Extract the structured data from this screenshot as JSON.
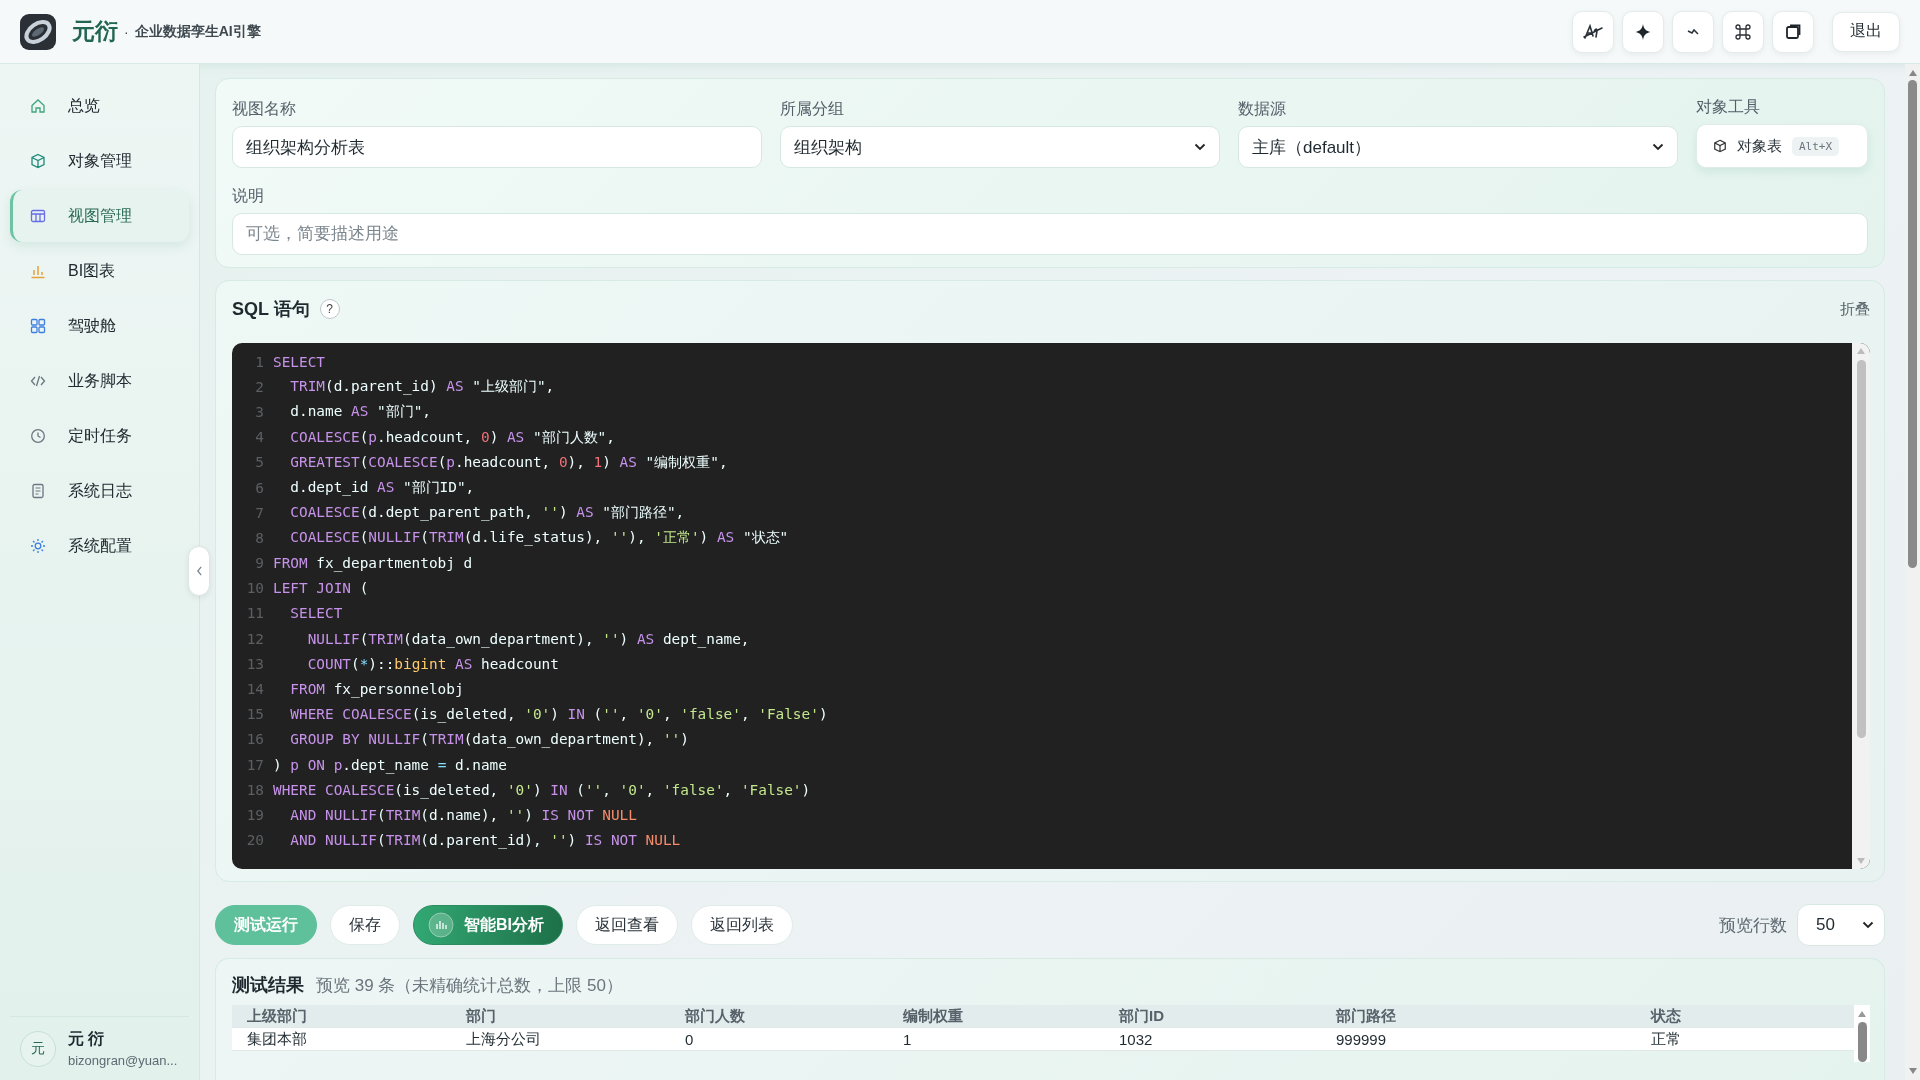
{
  "app": {
    "name": "元衍",
    "separator": "·",
    "tagline": "企业数据孪生AI引擎"
  },
  "toolbar": {
    "logout": "退出"
  },
  "sidebar": {
    "items": [
      {
        "label": "总览",
        "selected": false
      },
      {
        "label": "对象管理",
        "selected": false
      },
      {
        "label": "视图管理",
        "selected": true
      },
      {
        "label": "BI图表",
        "selected": false
      },
      {
        "label": "驾驶舱",
        "selected": false
      },
      {
        "label": "业务脚本",
        "selected": false
      },
      {
        "label": "定时任务",
        "selected": false
      },
      {
        "label": "系统日志",
        "selected": false
      },
      {
        "label": "系统配置",
        "selected": false
      }
    ]
  },
  "user": {
    "avatar": "元",
    "name": "元 衍",
    "email": "bizongran@yuan..."
  },
  "form": {
    "fields": [
      {
        "label": "视图名称",
        "value": "组织架构分析表",
        "kind": "input"
      },
      {
        "label": "所属分组",
        "value": "组织架构",
        "kind": "select"
      },
      {
        "label": "数据源",
        "value": "主库（default）",
        "kind": "select"
      }
    ],
    "object_tool": {
      "label": "对象工具",
      "button": "对象表",
      "shortcut": "Alt+X"
    },
    "description": {
      "label": "说明",
      "placeholder": "可选，简要描述用途"
    }
  },
  "sql": {
    "title": "SQL 语句",
    "help": "?",
    "collapse": "折叠",
    "lines": [
      {
        "n": "1",
        "tokens": [
          {
            "kind": "kw",
            "text": "SELECT"
          }
        ]
      },
      {
        "n": "2",
        "tokens": [
          {
            "kind": "kw",
            "text": "  TRIM"
          },
          {
            "kind": "plain",
            "text": "(d.parent_id) "
          },
          {
            "kind": "kw",
            "text": "AS"
          },
          {
            "kind": "plain",
            "text": " \"上级部门\","
          }
        ]
      },
      {
        "n": "3",
        "tokens": [
          {
            "kind": "plain",
            "text": "  d.name "
          },
          {
            "kind": "kw",
            "text": "AS"
          },
          {
            "kind": "plain",
            "text": " \"部门\","
          }
        ]
      },
      {
        "n": "4",
        "tokens": [
          {
            "kind": "kw",
            "text": "  COALESCE"
          },
          {
            "kind": "plain",
            "text": "("
          },
          {
            "kind": "kw",
            "text": "p"
          },
          {
            "kind": "plain",
            "text": ".headcount, "
          },
          {
            "kind": "num",
            "text": "0"
          },
          {
            "kind": "plain",
            "text": ") "
          },
          {
            "kind": "kw",
            "text": "AS"
          },
          {
            "kind": "plain",
            "text": " \"部门人数\","
          }
        ]
      },
      {
        "n": "5",
        "tokens": [
          {
            "kind": "kw",
            "text": "  GREATEST"
          },
          {
            "kind": "plain",
            "text": "("
          },
          {
            "kind": "kw",
            "text": "COALESCE"
          },
          {
            "kind": "plain",
            "text": "("
          },
          {
            "kind": "kw",
            "text": "p"
          },
          {
            "kind": "plain",
            "text": ".headcount, "
          },
          {
            "kind": "num",
            "text": "0"
          },
          {
            "kind": "plain",
            "text": "), "
          },
          {
            "kind": "num",
            "text": "1"
          },
          {
            "kind": "plain",
            "text": ") "
          },
          {
            "kind": "kw",
            "text": "AS"
          },
          {
            "kind": "plain",
            "text": " \"编制权重\","
          }
        ]
      },
      {
        "n": "6",
        "tokens": [
          {
            "kind": "plain",
            "text": "  d.dept_id "
          },
          {
            "kind": "kw",
            "text": "AS"
          },
          {
            "kind": "plain",
            "text": " \"部门ID\","
          }
        ]
      },
      {
        "n": "7",
        "tokens": [
          {
            "kind": "kw",
            "text": "  COALESCE"
          },
          {
            "kind": "plain",
            "text": "(d.dept_parent_path, "
          },
          {
            "kind": "str",
            "text": "''"
          },
          {
            "kind": "plain",
            "text": ") "
          },
          {
            "kind": "kw",
            "text": "AS"
          },
          {
            "kind": "plain",
            "text": " \"部门路径\","
          }
        ]
      },
      {
        "n": "8",
        "tokens": [
          {
            "kind": "kw",
            "text": "  COALESCE"
          },
          {
            "kind": "plain",
            "text": "("
          },
          {
            "kind": "kw",
            "text": "NULLIF"
          },
          {
            "kind": "plain",
            "text": "("
          },
          {
            "kind": "kw",
            "text": "TRIM"
          },
          {
            "kind": "plain",
            "text": "(d.life_status), "
          },
          {
            "kind": "str",
            "text": "''"
          },
          {
            "kind": "plain",
            "text": "), "
          },
          {
            "kind": "str",
            "text": "'正常'"
          },
          {
            "kind": "plain",
            "text": ") "
          },
          {
            "kind": "kw",
            "text": "AS"
          },
          {
            "kind": "plain",
            "text": " \"状态\""
          }
        ]
      },
      {
        "n": "9",
        "tokens": [
          {
            "kind": "kw",
            "text": "FROM"
          },
          {
            "kind": "plain",
            "text": " fx_departmentobj d"
          }
        ]
      },
      {
        "n": "10",
        "tokens": [
          {
            "kind": "kw",
            "text": "LEFT JOIN"
          },
          {
            "kind": "plain",
            "text": " ("
          }
        ]
      },
      {
        "n": "11",
        "tokens": [
          {
            "kind": "kw",
            "text": "  SELECT"
          }
        ]
      },
      {
        "n": "12",
        "tokens": [
          {
            "kind": "kw",
            "text": "    NULLIF"
          },
          {
            "kind": "plain",
            "text": "("
          },
          {
            "kind": "kw",
            "text": "TRIM"
          },
          {
            "kind": "plain",
            "text": "(data_own_department), "
          },
          {
            "kind": "str",
            "text": "''"
          },
          {
            "kind": "plain",
            "text": ") "
          },
          {
            "kind": "kw",
            "text": "AS"
          },
          {
            "kind": "plain",
            "text": " dept_name,"
          }
        ]
      },
      {
        "n": "13",
        "tokens": [
          {
            "kind": "kw",
            "text": "    COUNT"
          },
          {
            "kind": "plain",
            "text": "("
          },
          {
            "kind": "op",
            "text": "*"
          },
          {
            "kind": "plain",
            "text": ")::"
          },
          {
            "kind": "type",
            "text": "bigint"
          },
          {
            "kind": "kw",
            "text": " AS"
          },
          {
            "kind": "plain",
            "text": " headcount"
          }
        ]
      },
      {
        "n": "14",
        "tokens": [
          {
            "kind": "kw",
            "text": "  FROM"
          },
          {
            "kind": "plain",
            "text": " fx_personnelobj"
          }
        ]
      },
      {
        "n": "15",
        "tokens": [
          {
            "kind": "kw",
            "text": "  WHERE COALESCE"
          },
          {
            "kind": "plain",
            "text": "(is_deleted, "
          },
          {
            "kind": "str",
            "text": "'0'"
          },
          {
            "kind": "plain",
            "text": ") "
          },
          {
            "kind": "kw",
            "text": "IN"
          },
          {
            "kind": "plain",
            "text": " ("
          },
          {
            "kind": "str",
            "text": "''"
          },
          {
            "kind": "plain",
            "text": ", "
          },
          {
            "kind": "str",
            "text": "'0'"
          },
          {
            "kind": "plain",
            "text": ", "
          },
          {
            "kind": "str",
            "text": "'false'"
          },
          {
            "kind": "plain",
            "text": ", "
          },
          {
            "kind": "str",
            "text": "'False'"
          },
          {
            "kind": "plain",
            "text": ")"
          }
        ]
      },
      {
        "n": "16",
        "tokens": [
          {
            "kind": "kw",
            "text": "  GROUP BY NULLIF"
          },
          {
            "kind": "plain",
            "text": "("
          },
          {
            "kind": "kw",
            "text": "TRIM"
          },
          {
            "kind": "plain",
            "text": "(data_own_department), "
          },
          {
            "kind": "str",
            "text": "''"
          },
          {
            "kind": "plain",
            "text": ")"
          }
        ]
      },
      {
        "n": "17",
        "tokens": [
          {
            "kind": "plain",
            "text": ") "
          },
          {
            "kind": "kw",
            "text": "p ON p"
          },
          {
            "kind": "plain",
            "text": ".dept_name "
          },
          {
            "kind": "op",
            "text": "="
          },
          {
            "kind": "plain",
            "text": " d.name"
          }
        ]
      },
      {
        "n": "18",
        "tokens": [
          {
            "kind": "kw",
            "text": "WHERE COALESCE"
          },
          {
            "kind": "plain",
            "text": "(is_deleted, "
          },
          {
            "kind": "str",
            "text": "'0'"
          },
          {
            "kind": "plain",
            "text": ") "
          },
          {
            "kind": "kw",
            "text": "IN"
          },
          {
            "kind": "plain",
            "text": " ("
          },
          {
            "kind": "str",
            "text": "''"
          },
          {
            "kind": "plain",
            "text": ", "
          },
          {
            "kind": "str",
            "text": "'0'"
          },
          {
            "kind": "plain",
            "text": ", "
          },
          {
            "kind": "str",
            "text": "'false'"
          },
          {
            "kind": "plain",
            "text": ", "
          },
          {
            "kind": "str",
            "text": "'False'"
          },
          {
            "kind": "plain",
            "text": ")"
          }
        ]
      },
      {
        "n": "19",
        "tokens": [
          {
            "kind": "kw",
            "text": "  AND NULLIF"
          },
          {
            "kind": "plain",
            "text": "("
          },
          {
            "kind": "kw",
            "text": "TRIM"
          },
          {
            "kind": "plain",
            "text": "(d.name), "
          },
          {
            "kind": "str",
            "text": "''"
          },
          {
            "kind": "plain",
            "text": ") "
          },
          {
            "kind": "kw",
            "text": "IS NOT"
          },
          {
            "kind": "null",
            "text": " NULL"
          }
        ]
      },
      {
        "n": "20",
        "tokens": [
          {
            "kind": "kw",
            "text": "  AND NULLIF"
          },
          {
            "kind": "plain",
            "text": "("
          },
          {
            "kind": "kw",
            "text": "TRIM"
          },
          {
            "kind": "plain",
            "text": "(d.parent_id), "
          },
          {
            "kind": "str",
            "text": "''"
          },
          {
            "kind": "plain",
            "text": ") "
          },
          {
            "kind": "kw",
            "text": "IS NOT"
          },
          {
            "kind": "null",
            "text": " NULL"
          }
        ]
      }
    ]
  },
  "actions": [
    {
      "label": "测试运行",
      "kind": "run"
    },
    {
      "label": "保存",
      "kind": "plain"
    },
    {
      "label": "智能BI分析",
      "kind": "ai"
    },
    {
      "label": "返回查看",
      "kind": "plain"
    },
    {
      "label": "返回列表",
      "kind": "plain"
    }
  ],
  "preview_rows": {
    "label": "预览行数",
    "value": "50"
  },
  "results": {
    "title": "测试结果",
    "summary": "预览 39 条（未精确统计总数，上限 50）",
    "columns": [
      "上级部门",
      "部门",
      "部门人数",
      "编制权重",
      "部门ID",
      "部门路径",
      "状态"
    ],
    "rows": [
      [
        "集团本部",
        "上海分公司",
        "0",
        "1",
        "1032",
        "999999",
        "正常"
      ]
    ]
  }
}
